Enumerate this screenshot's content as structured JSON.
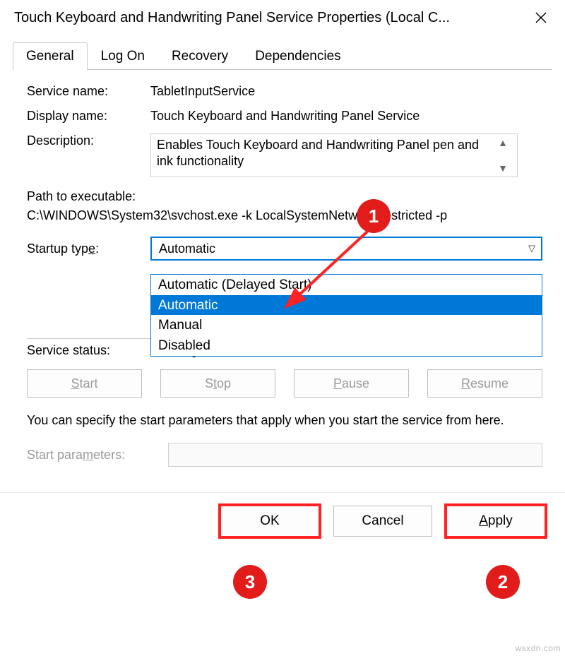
{
  "title": "Touch Keyboard and Handwriting Panel Service Properties (Local C...",
  "tabs": {
    "general": "General",
    "logon": "Log On",
    "recovery": "Recovery",
    "dependencies": "Dependencies"
  },
  "labels": {
    "service_name": "Service name:",
    "display_name": "Display name:",
    "description": "Description:",
    "path": "Path to executable:",
    "startup_type_pre": "Startup typ",
    "startup_type_u": "e",
    "startup_type_post": ":",
    "service_status": "Service status:",
    "help_text": "You can specify the start parameters that apply when you start the service from here.",
    "start_params_pre": "Start para",
    "start_params_u": "m",
    "start_params_post": "eters:"
  },
  "values": {
    "service_name": "TabletInputService",
    "display_name": "Touch Keyboard and Handwriting Panel Service",
    "description": "Enables Touch Keyboard and Handwriting Panel pen and ink functionality",
    "path": "C:\\WINDOWS\\System32\\svchost.exe -k LocalSystemNetworkRestricted -p",
    "startup_selected": "Automatic",
    "service_status": "Running"
  },
  "startup_options": [
    "Automatic (Delayed Start)",
    "Automatic",
    "Manual",
    "Disabled"
  ],
  "buttons": {
    "start_u": "S",
    "start_post": "tart",
    "stop_pre": "S",
    "stop_u": "t",
    "stop_post": "op",
    "pause_u": "P",
    "pause_post": "ause",
    "resume_u": "R",
    "resume_post": "esume",
    "ok": "OK",
    "cancel": "Cancel",
    "apply_u": "A",
    "apply_post": "pply"
  },
  "annotations": {
    "b1": "1",
    "b2": "2",
    "b3": "3"
  },
  "watermark": "wsxdn.com"
}
